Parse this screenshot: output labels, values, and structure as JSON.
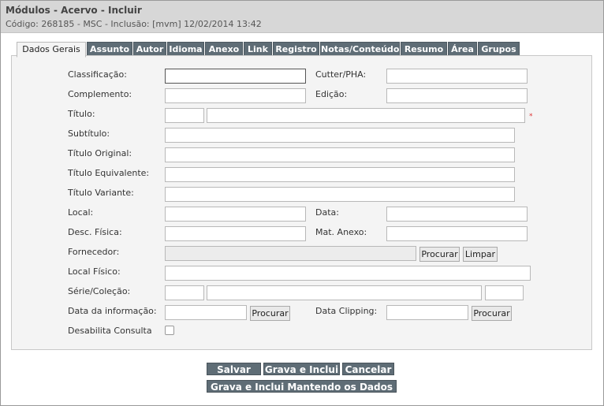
{
  "header": {
    "title": "Módulos - Acervo - Incluir",
    "subtitle": "Código: 268185 - MSC - Inclusão: [mvm] 12/02/2014 13:42"
  },
  "tabs": [
    {
      "label": "Dados Gerais"
    },
    {
      "label": "Assunto"
    },
    {
      "label": "Autor"
    },
    {
      "label": "Idioma"
    },
    {
      "label": "Anexo"
    },
    {
      "label": "Link"
    },
    {
      "label": "Registro"
    },
    {
      "label": "Notas/Conteúdo"
    },
    {
      "label": "Resumo"
    },
    {
      "label": "Área"
    },
    {
      "label": "Grupos"
    }
  ],
  "form": {
    "classificacao": "Classificação:",
    "cutter": "Cutter/PHA:",
    "complemento": "Complemento:",
    "edicao": "Edição:",
    "titulo": "Título:",
    "required_mark": "*",
    "subtitulo": "Subtítulo:",
    "titulo_original": "Título Original:",
    "titulo_equivalente": "Título Equivalente:",
    "titulo_variante": "Título Variante:",
    "local": "Local:",
    "data": "Data:",
    "desc_fisica": "Desc. Física:",
    "mat_anexo": "Mat. Anexo:",
    "fornecedor": "Fornecedor:",
    "local_fisico": "Local Físico:",
    "serie_colecao": "Série/Coleção:",
    "data_informacao": "Data da informação:",
    "data_clipping": "Data Clipping:",
    "desabilita_consulta": "Desabilita Consulta",
    "procurar": "Procurar",
    "limpar": "Limpar"
  },
  "actions": {
    "salvar": "Salvar",
    "grava_inclui": "Grava e Inclui",
    "cancelar": "Cancelar",
    "grava_inclui_mantendo": "Grava e Inclui Mantendo os Dados"
  }
}
